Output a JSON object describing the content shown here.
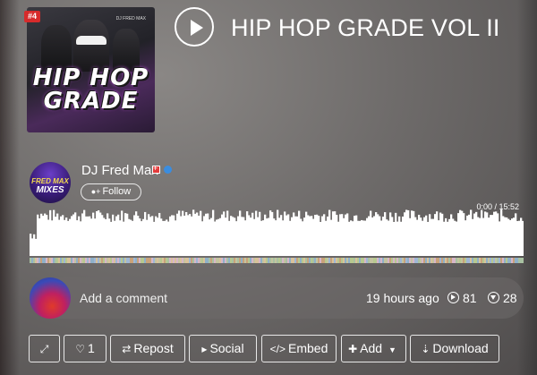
{
  "track": {
    "rank_badge": "#4",
    "title": "HIP HOP GRADE VOL II",
    "cover_text_line1": "HIP HOP",
    "cover_text_line2": "GRADE",
    "cover_tag": "DJ FRED MAX"
  },
  "artist": {
    "name": "DJ Fred Max",
    "avatar_line1": "FRED MAX",
    "avatar_line2": "MIXES",
    "follow_label": "Follow"
  },
  "player": {
    "time_readout": "0:00 / 15:52",
    "progress": 0
  },
  "comment": {
    "placeholder": "Add a comment",
    "posted": "19 hours ago",
    "plays": "81",
    "downloads": "28"
  },
  "actions": {
    "like_count": "1",
    "repost": "Repost",
    "social": "Social",
    "embed": "Embed",
    "add": "Add",
    "download": "Download"
  },
  "colors": {
    "badge": "#d62b2b",
    "verified": "#3a8de0",
    "waveform": "#ffffff"
  }
}
